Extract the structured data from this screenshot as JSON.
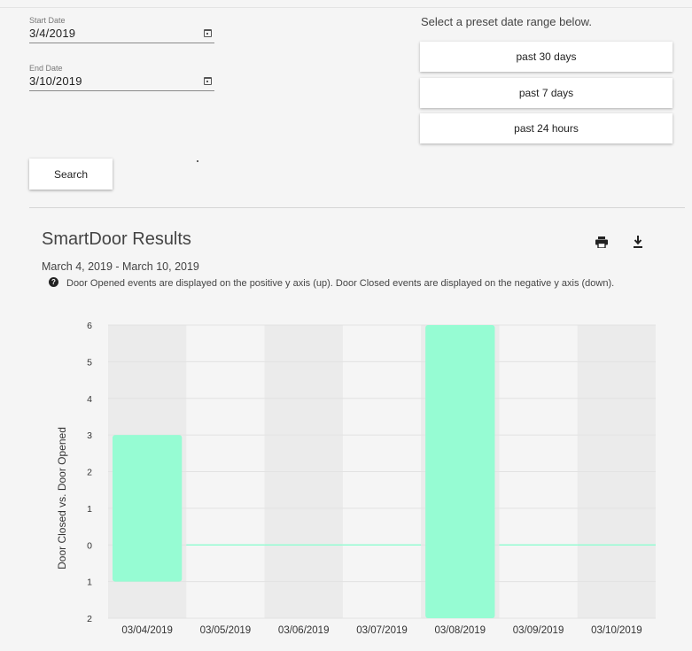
{
  "form": {
    "start_label": "Start Date",
    "start_value": "3/4/2019",
    "end_label": "End Date",
    "end_value": "3/10/2019",
    "search_label": "Search"
  },
  "presets": {
    "hint": "Select a preset date range below.",
    "buttons": [
      "past 30 days",
      "past 7 days",
      "past 24 hours"
    ]
  },
  "results": {
    "title": "SmartDoor Results",
    "date_range": "March 4, 2019 - March 10, 2019",
    "note": "Door Opened events are displayed on the positive y axis (up). Door Closed events are displayed on the negative y axis (down).",
    "print_icon": "print-icon",
    "download_icon": "download-icon"
  },
  "chart_data": {
    "type": "bar",
    "categories": [
      "03/04/2019",
      "03/05/2019",
      "03/06/2019",
      "03/07/2019",
      "03/08/2019",
      "03/09/2019",
      "03/10/2019"
    ],
    "series": [
      {
        "values": [
          3,
          0,
          0,
          0,
          6,
          0,
          0
        ]
      },
      {
        "values": [
          -1,
          0,
          0,
          0,
          -2,
          0,
          0
        ]
      }
    ],
    "ylabel": "Door Closed vs. Door Opened",
    "ylim": [
      -2,
      6
    ],
    "ytick_labels": [
      "2",
      "1",
      "0",
      "1",
      "2",
      "3",
      "4",
      "5",
      "6"
    ],
    "grid": true,
    "bar_color": "#96fcd3",
    "band_color": "#ebebeb"
  }
}
